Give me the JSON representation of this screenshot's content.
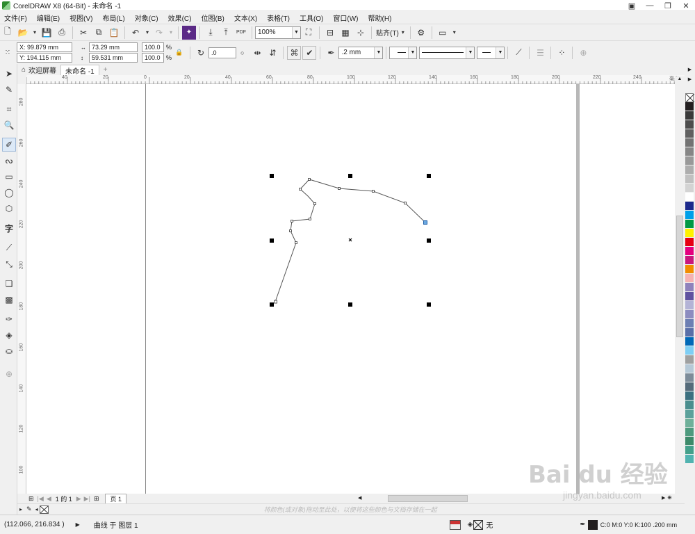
{
  "window": {
    "title": "CorelDRAW X8 (64-Bit) - 未命名 -1"
  },
  "menu": [
    "文件(F)",
    "编辑(E)",
    "视图(V)",
    "布局(L)",
    "对象(C)",
    "效果(C)",
    "位图(B)",
    "文本(X)",
    "表格(T)",
    "工具(O)",
    "窗口(W)",
    "帮助(H)"
  ],
  "toolbar1": {
    "zoom_value": "100%",
    "snap_label": "贴齐(T)",
    "pdf_label": "PDF"
  },
  "toolbar2": {
    "x": "X: 99.879 mm",
    "y": "Y: 194.115 mm",
    "width": "73.29 mm",
    "height": "59.531 mm",
    "scale_x": "100.0",
    "scale_y": "100.0",
    "percent": "%",
    "rotation": ".0",
    "outline_width": ".2 mm"
  },
  "tabs": {
    "welcome": "欢迎屏幕",
    "document": "未命名 -1",
    "add": "+"
  },
  "ruler_top_labels": [
    "40",
    "20",
    "0",
    "20",
    "40",
    "60",
    "80",
    "100",
    "120",
    "140",
    "160",
    "180",
    "200",
    "220",
    "240"
  ],
  "ruler_top_unit": "毫米",
  "ruler_left_labels": [
    "280",
    "260",
    "240",
    "220",
    "200",
    "180",
    "160",
    "140",
    "120",
    "100",
    "80"
  ],
  "pagenav": {
    "page_of": "1 的 1",
    "page_tab": "页 1"
  },
  "colorrow": {
    "hint": "将颜色(或对象)拖动至此处，以便将这些颜色与文档存储在一起"
  },
  "status": {
    "coords": "(112.066, 216.834 )",
    "object_info": "曲线 于 图层 1",
    "fill_label": "无",
    "outline_info": "C:0 M:0 Y:0 K:100  .200 mm"
  },
  "palette_colors": [
    "#231f20",
    "#3a3a3a",
    "#4d4d4d",
    "#606060",
    "#737373",
    "#868686",
    "#999999",
    "#adadad",
    "#c0c0c0",
    "#d3d3d3",
    "#ffffff",
    "#1c2a8c",
    "#00a0e9",
    "#009944",
    "#fff100",
    "#e60012",
    "#e4007f",
    "#c9177e",
    "#f18d00",
    "#f5b2b2",
    "#8f82bc",
    "#5f52a0",
    "#b3b3d6",
    "#8c8cc0",
    "#6d7fb3",
    "#5a6fa8",
    "#0068b7",
    "#7ecef4",
    "#9fa0a0",
    "#b5c8d6",
    "#7d8c99",
    "#556b7a",
    "#3c7080",
    "#4a8e8e",
    "#5ba19b",
    "#6fb09a",
    "#4e9a7e",
    "#3d8a6a",
    "#44a08b",
    "#51b3b0"
  ],
  "watermark": {
    "brand": "Bai du 经验",
    "url": "jingyan.baidu.com"
  }
}
